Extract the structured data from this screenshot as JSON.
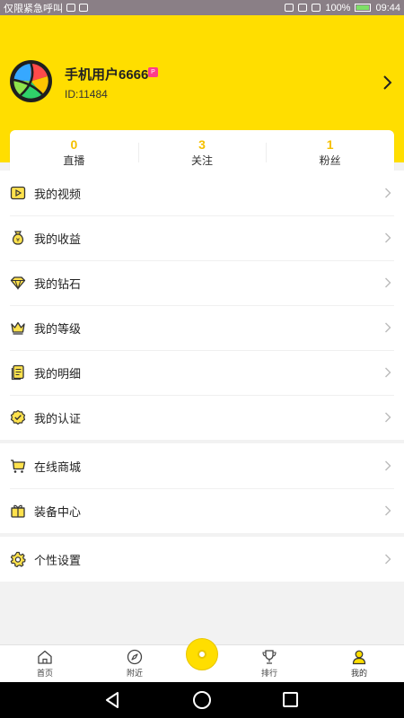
{
  "status_bar": {
    "carrier": "仅限紧急呼叫",
    "battery": "100%",
    "time": "09:44"
  },
  "profile": {
    "username": "手机用户6666",
    "badge": "P",
    "id": "ID:11484"
  },
  "stats": [
    {
      "value": "0",
      "label": "直播"
    },
    {
      "value": "3",
      "label": "关注"
    },
    {
      "value": "1",
      "label": "粉丝"
    }
  ],
  "menu_group_1": [
    {
      "label": "我的视频",
      "icon": "video-icon"
    },
    {
      "label": "我的收益",
      "icon": "money-bag-icon"
    },
    {
      "label": "我的钻石",
      "icon": "diamond-icon"
    },
    {
      "label": "我的等级",
      "icon": "crown-icon"
    },
    {
      "label": "我的明细",
      "icon": "detail-list-icon"
    },
    {
      "label": "我的认证",
      "icon": "verified-icon"
    }
  ],
  "menu_group_2": [
    {
      "label": "在线商城",
      "icon": "cart-icon"
    },
    {
      "label": "装备中心",
      "icon": "gift-box-icon"
    }
  ],
  "menu_group_3": [
    {
      "label": "个性设置",
      "icon": "gear-icon"
    }
  ],
  "tabs": [
    {
      "label": "首页",
      "icon": "home-icon"
    },
    {
      "label": "附近",
      "icon": "compass-icon"
    },
    {
      "label": "排行",
      "icon": "trophy-icon"
    },
    {
      "label": "我的",
      "icon": "user-icon"
    }
  ],
  "colors": {
    "accent": "#ffde00",
    "stat_number": "#f5c000",
    "badge": "#ff3b8a"
  }
}
